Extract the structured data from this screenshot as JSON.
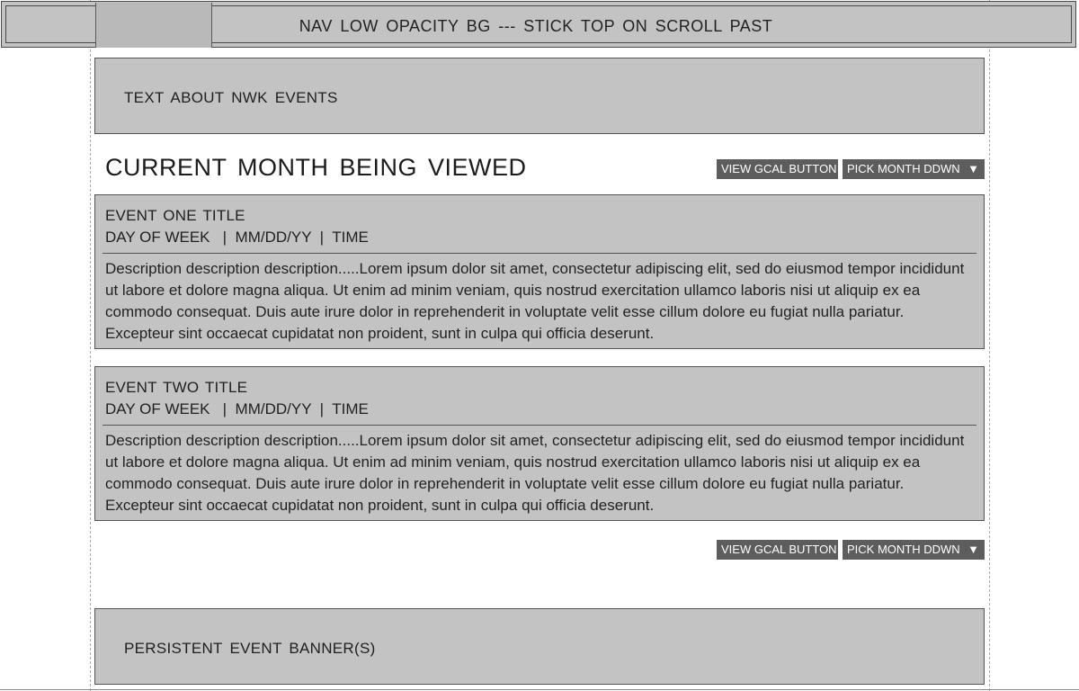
{
  "nav": {
    "label": "NAV  LOW  OPACITY  BG  ---  STICK  TOP  ON  SCROLL  PAST"
  },
  "intro": {
    "text": "TEXT  ABOUT  NWK  EVENTS"
  },
  "month": {
    "title": "CURRENT  MONTH  BEING  VIEWED"
  },
  "controls": {
    "gcal_label": "VIEW GCAL BUTTON",
    "month_label": "PICK MONTH DDWN",
    "caret_icon": "triangle-down-icon"
  },
  "events": [
    {
      "title": "EVENT  ONE  TITLE",
      "meta": "DAY OF WEEK   |  MM/DD/YY  |  TIME",
      "description": "Description description description.....Lorem ipsum dolor sit amet, consectetur adipiscing elit, sed do eiusmod tempor incididunt ut labore et dolore magna aliqua. Ut enim ad minim veniam, quis nostrud exercitation ullamco laboris nisi ut aliquip ex ea commodo consequat. Duis aute irure dolor in reprehenderit in voluptate velit esse cillum dolore eu fugiat nulla pariatur. Excepteur sint occaecat cupidatat non proident, sunt in culpa qui officia deserunt."
    },
    {
      "title": "EVENT TWO  TITLE",
      "meta": "DAY OF WEEK   |  MM/DD/YY  |  TIME",
      "description": "Description description description.....Lorem ipsum dolor sit amet, consectetur adipiscing elit, sed do eiusmod tempor incididunt ut labore et dolore magna aliqua. Ut enim ad minim veniam, quis nostrud exercitation ullamco laboris nisi ut aliquip ex ea commodo consequat. Duis aute irure dolor in reprehenderit in voluptate velit esse cillum dolore eu fugiat nulla pariatur. Excepteur sint occaecat cupidatat non proident, sunt in culpa qui officia deserunt."
    }
  ],
  "banner": {
    "text": "PERSISTENT  EVENT  BANNER(S)"
  },
  "colors": {
    "box_fill": "#c3c3c3",
    "button_fill": "#5d5d5d",
    "border": "#555555"
  }
}
